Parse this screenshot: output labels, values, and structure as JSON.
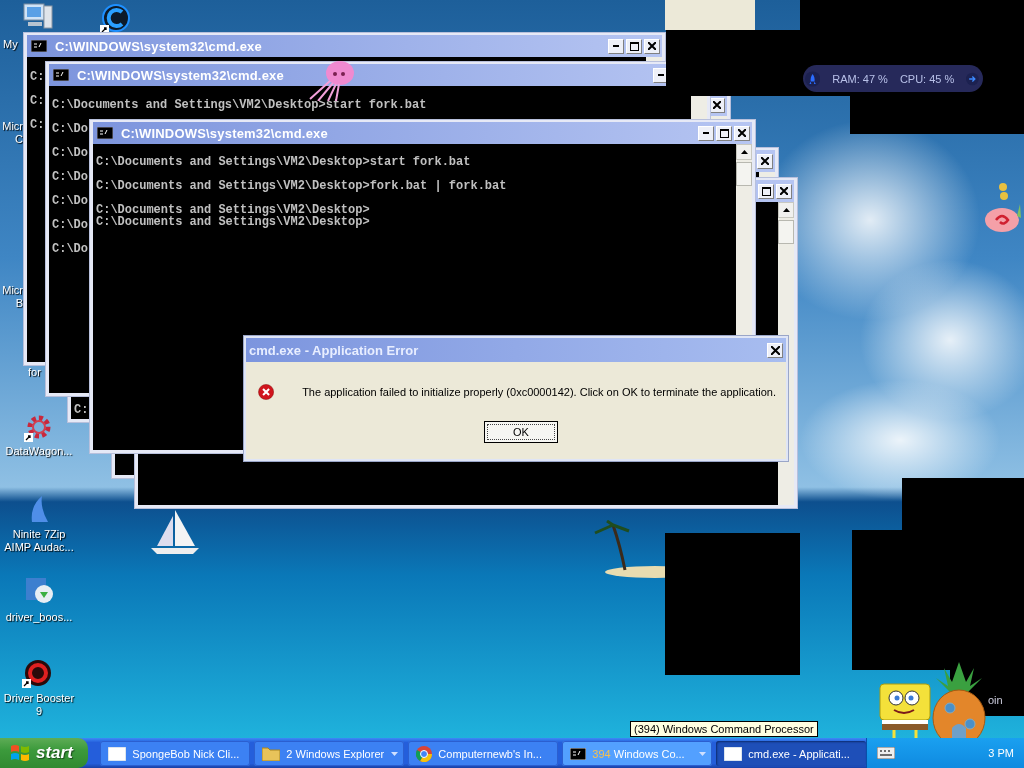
{
  "desktop_icons": [
    {
      "kind": "computer",
      "shortcut": false,
      "lines": [
        "My"
      ]
    },
    {
      "kind": "c-logo",
      "shortcut": true
    },
    {
      "kind": "none",
      "shortcut": false,
      "lines": [
        "Micr",
        "C"
      ]
    },
    {
      "kind": "none",
      "shortcut": false,
      "lines": [
        "Micr",
        "B"
      ]
    },
    {
      "kind": "none",
      "shortcut": false,
      "lines": [
        "for"
      ]
    },
    {
      "kind": "gear",
      "shortcut": true,
      "lines": [
        "DataWagon..."
      ]
    },
    {
      "kind": "shark",
      "shortcut": false,
      "lines": [
        "Ninite 7Zip",
        "AIMP Audac..."
      ]
    },
    {
      "kind": "installer",
      "shortcut": false,
      "lines": [
        "driver_boos..."
      ]
    },
    {
      "kind": "booster",
      "shortcut": true,
      "lines": [
        "Driver Booster",
        "9"
      ]
    }
  ],
  "cmd_windows": [
    {
      "title": "C:\\WINDOWS\\system32\\cmd.exe",
      "blocks": [
        [
          "C:"
        ],
        [
          "C:"
        ],
        [
          "C:"
        ]
      ]
    },
    {
      "title": "C:\\WINDOWS\\system32\\cmd.exe",
      "blocks": [
        [
          "C:\\Documents and Settings\\VM2\\Desktop>start fork.bat"
        ],
        [
          "C:\\Do"
        ],
        [
          "C:\\Do"
        ],
        [
          "C:\\Do"
        ],
        [
          "C:\\Do"
        ],
        [
          "C:\\Do"
        ],
        [
          "C:\\Do"
        ]
      ]
    },
    {
      "blocks": [
        [
          "C:"
        ]
      ]
    },
    {
      "title": "C:\\WINDOWS\\system32\\cmd.exe",
      "blocks": [
        [
          "C:\\Documents and Settings\\VM2\\Desktop>start fork.bat"
        ],
        [
          "C:\\Documents and Settings\\VM2\\Desktop>fork.bat | fork.bat"
        ],
        [
          "C:\\Documents and Settings\\VM2\\Desktop>",
          "C:\\Documents and Settings\\VM2\\Desktop>"
        ]
      ]
    }
  ],
  "error_dialog": {
    "title": "cmd.exe - Application Error",
    "message": "The application failed to initialize properly (0xc0000142). Click on OK to terminate the application.",
    "button": "OK"
  },
  "monitor_widget": {
    "ram": "RAM: 47 %",
    "cpu": "CPU: 45 %"
  },
  "corner_text": "oin",
  "tooltip": "(394) Windows Command Processor",
  "taskbar": {
    "start": "start",
    "tasks": [
      {
        "kind": "window",
        "label": "SpongeBob Nick Cli...",
        "grouped": false,
        "hovered": false,
        "selected": false
      },
      {
        "kind": "folder",
        "count": "2",
        "label": "Windows Explorer",
        "grouped": true,
        "hovered": false,
        "selected": false
      },
      {
        "kind": "browser",
        "label": "Computernewb's In...",
        "grouped": false,
        "hovered": false,
        "selected": false
      },
      {
        "kind": "console",
        "count": "394",
        "label": "Windows Co...",
        "grouped": true,
        "hovered": true,
        "selected": false
      },
      {
        "kind": "window",
        "label": "cmd.exe - Applicati...",
        "grouped": false,
        "hovered": false,
        "selected": true
      }
    ],
    "clock": "3 PM"
  }
}
